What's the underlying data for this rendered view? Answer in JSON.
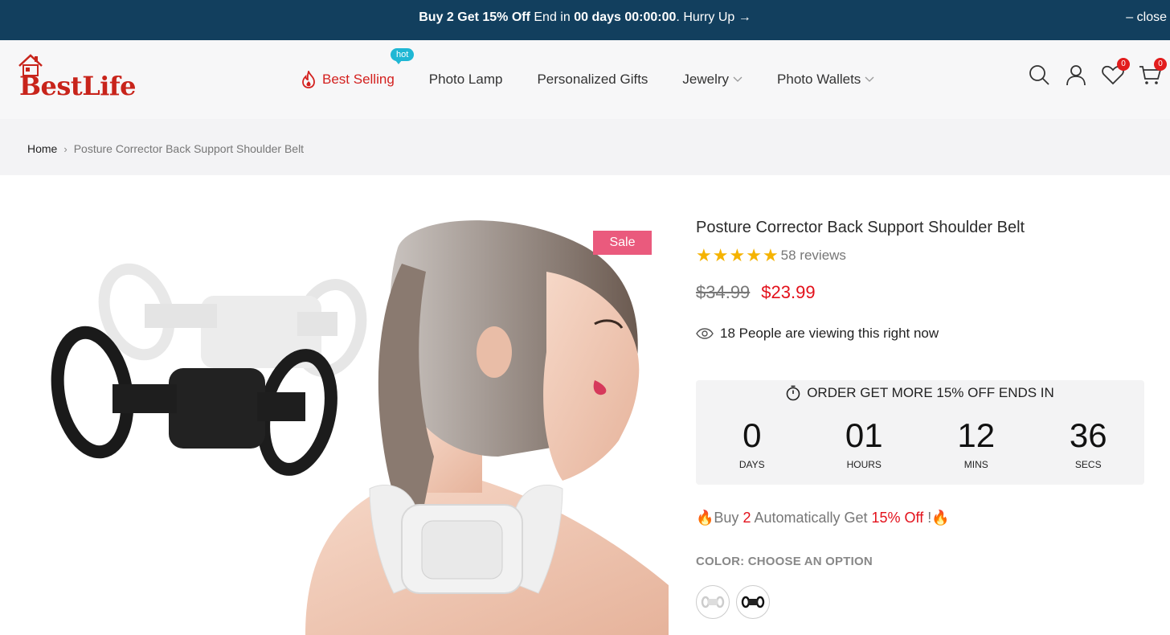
{
  "announcement": {
    "bold_text": "Buy 2 Get 15% Off",
    "text": " End in ",
    "timer_days": "00 days",
    "timer_clock": " 00:00:00",
    "cta": ". Hurry Up →",
    "close_label": "– close"
  },
  "header": {
    "logo_text": "BestLife",
    "nav": [
      {
        "label": "Best Selling",
        "badge": "hot",
        "color": "#d3201e"
      },
      {
        "label": "Photo Lamp"
      },
      {
        "label": "Personalized Gifts"
      },
      {
        "label": "Jewelry"
      },
      {
        "label": "Photo Wallets"
      }
    ],
    "wishlist_count": "0",
    "cart_count": "0"
  },
  "breadcrumb": {
    "home": "Home",
    "current": "Posture Corrector Back Support Shoulder Belt"
  },
  "gallery": {
    "sale_badge": "Sale"
  },
  "product": {
    "title": "Posture Corrector Back Support Shoulder Belt",
    "rating": 5,
    "reviews": "58 reviews",
    "old_price": "$34.99",
    "new_price": "$23.99",
    "viewing": "18 People are viewing this right now",
    "countdown": {
      "heading": "ORDER GET MORE 15% OFF ENDS IN",
      "units": [
        {
          "value": "0",
          "label": "DAYS"
        },
        {
          "value": "01",
          "label": "HOURS"
        },
        {
          "value": "12",
          "label": "MINS"
        },
        {
          "value": "36",
          "label": "SECS"
        }
      ]
    },
    "promo": {
      "lead": "🔥Buy ",
      "qty": "2",
      "mid": " Automatically Get ",
      "discount": "15% Off",
      "tail": " !🔥"
    },
    "color_label": "COLOR: CHOOSE AN OPTION",
    "swatches": [
      "white",
      "black"
    ]
  },
  "colors": {
    "topbar_bg": "#123f5e",
    "accent_red": "#e3111b",
    "sale_pink": "#ea5a7d",
    "hot_cyan": "#1fb7d4",
    "star_gold": "#f5b301"
  }
}
